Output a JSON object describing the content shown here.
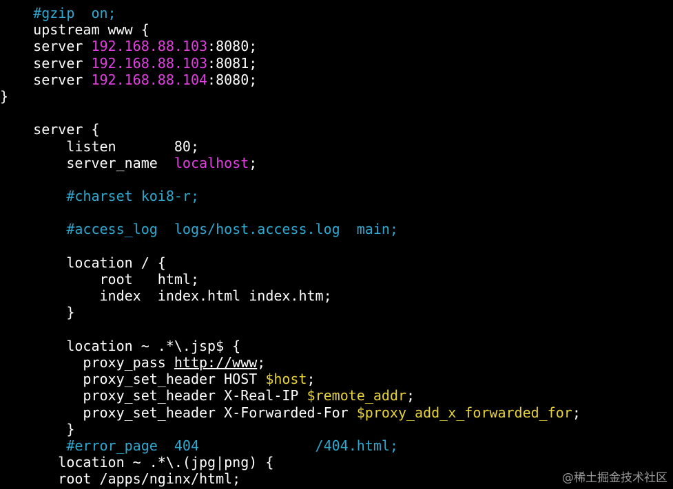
{
  "colors": {
    "background": "#000000",
    "text": "#ffffff",
    "comment": "#2ea8d0",
    "ip_string": "#e23ee2",
    "variable": "#e8d33a"
  },
  "code_lines": [
    [
      {
        "t": "    ",
        "k": "plain"
      },
      {
        "t": "#gzip  on;",
        "k": "comment"
      }
    ],
    [
      {
        "t": "    upstream www {",
        "k": "plain"
      }
    ],
    [
      {
        "t": "    server ",
        "k": "plain"
      },
      {
        "t": "192.168.88.103",
        "k": "ip"
      },
      {
        "t": ":8080;",
        "k": "plain"
      }
    ],
    [
      {
        "t": "    server ",
        "k": "plain"
      },
      {
        "t": "192.168.88.103",
        "k": "ip"
      },
      {
        "t": ":8081;",
        "k": "plain"
      }
    ],
    [
      {
        "t": "    server ",
        "k": "plain"
      },
      {
        "t": "192.168.88.104",
        "k": "ip"
      },
      {
        "t": ":8080;",
        "k": "plain"
      }
    ],
    [
      {
        "t": "}",
        "k": "plain"
      }
    ],
    [
      {
        "t": "",
        "k": "plain"
      }
    ],
    [
      {
        "t": "    server {",
        "k": "plain"
      }
    ],
    [
      {
        "t": "        listen       80;",
        "k": "plain"
      }
    ],
    [
      {
        "t": "        server_name  ",
        "k": "plain"
      },
      {
        "t": "localhost",
        "k": "string"
      },
      {
        "t": ";",
        "k": "plain"
      }
    ],
    [
      {
        "t": "",
        "k": "plain"
      }
    ],
    [
      {
        "t": "        ",
        "k": "plain"
      },
      {
        "t": "#charset koi8-r;",
        "k": "comment"
      }
    ],
    [
      {
        "t": "",
        "k": "plain"
      }
    ],
    [
      {
        "t": "        ",
        "k": "plain"
      },
      {
        "t": "#access_log  logs/host.access.log  main;",
        "k": "comment"
      }
    ],
    [
      {
        "t": "",
        "k": "plain"
      }
    ],
    [
      {
        "t": "        location / {",
        "k": "plain"
      }
    ],
    [
      {
        "t": "            root   html;",
        "k": "plain"
      }
    ],
    [
      {
        "t": "            index  index.html index.htm;",
        "k": "plain"
      }
    ],
    [
      {
        "t": "        }",
        "k": "plain"
      }
    ],
    [
      {
        "t": "",
        "k": "plain"
      }
    ],
    [
      {
        "t": "        location ~ .*\\.jsp$ {",
        "k": "plain"
      }
    ],
    [
      {
        "t": "          proxy_pass ",
        "k": "plain"
      },
      {
        "t": "http://www",
        "k": "url"
      },
      {
        "t": ";",
        "k": "plain"
      }
    ],
    [
      {
        "t": "          proxy_set_header HOST ",
        "k": "plain"
      },
      {
        "t": "$host",
        "k": "var"
      },
      {
        "t": ";",
        "k": "plain"
      }
    ],
    [
      {
        "t": "          proxy_set_header X-Real-IP ",
        "k": "plain"
      },
      {
        "t": "$remote_addr",
        "k": "var"
      },
      {
        "t": ";",
        "k": "plain"
      }
    ],
    [
      {
        "t": "          proxy_set_header X-Forwarded-For ",
        "k": "plain"
      },
      {
        "t": "$proxy_add_x_forwarded_for",
        "k": "var"
      },
      {
        "t": ";",
        "k": "plain"
      }
    ],
    [
      {
        "t": "        }",
        "k": "plain"
      }
    ],
    [
      {
        "t": "        ",
        "k": "plain"
      },
      {
        "t": "#error_page  404              /404.html;",
        "k": "comment"
      }
    ],
    [
      {
        "t": "       location ~ .*\\.(jpg|png) {",
        "k": "plain"
      }
    ],
    [
      {
        "t": "       root /apps/nginx/html;",
        "k": "plain"
      }
    ]
  ],
  "watermark": "@稀土掘金技术社区"
}
